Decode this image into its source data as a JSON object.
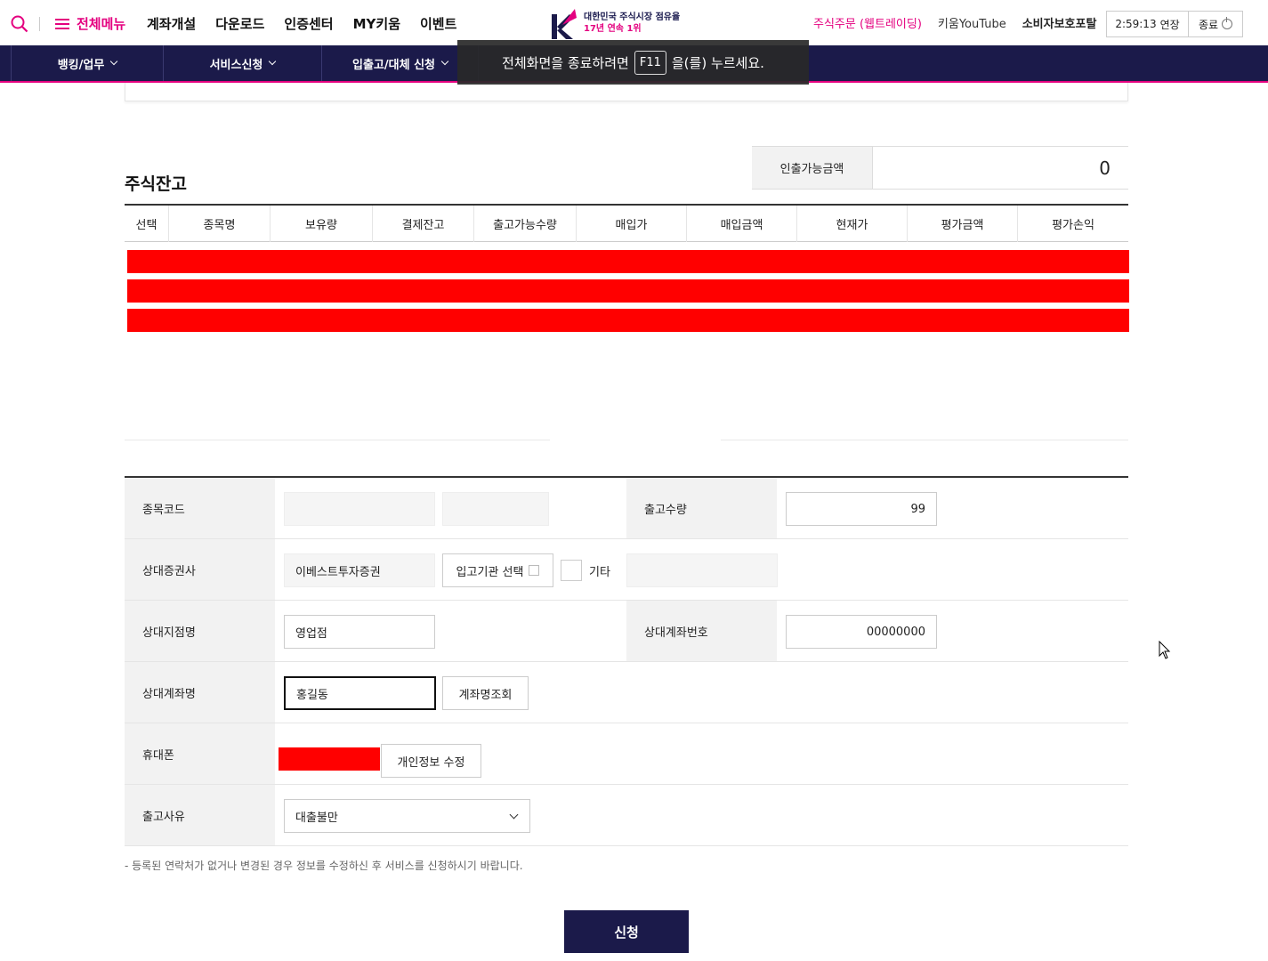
{
  "header": {
    "menu_all": "전체메뉴",
    "nav": [
      "계좌개설",
      "다운로드",
      "인증센터",
      "MY키움",
      "이벤트"
    ],
    "logo_line1": "대한민국 주식시장 점유율",
    "logo_line2": "17년 연속 1위",
    "links": [
      "주식주문 (웹트레이딩)",
      "키움YouTube",
      "소비자보호포탈"
    ],
    "timer": "2:59:13",
    "extend": "연장",
    "logout": "종료"
  },
  "navbar": {
    "items": [
      "뱅킹/업무",
      "서비스신청",
      "입출고/대체 신청"
    ]
  },
  "toast": {
    "before": "전체화면을 종료하려면",
    "key": "F11",
    "after": "을(를) 누르세요."
  },
  "stock": {
    "title": "주식잔고",
    "withdraw_label": "인출가능금액",
    "withdraw_value": "0",
    "columns": [
      "선택",
      "종목명",
      "보유량",
      "결제잔고",
      "출고가능수량",
      "매입가",
      "매입금액",
      "현재가",
      "평가금액",
      "평가손익"
    ]
  },
  "form": {
    "code_label": "종목코드",
    "qty_label": "출고수량",
    "qty_value": "99",
    "broker_label": "상대증권사",
    "broker_value": "이베스트투자증권",
    "broker_select": "입고기관 선택",
    "other_label": "기타",
    "branch_label": "상대지점명",
    "branch_value": "영업점",
    "account_no_label": "상대계좌번호",
    "account_no_value": "00000000",
    "account_name_label": "상대계좌명",
    "account_name_value": "홍길동",
    "account_lookup": "계좌명조회",
    "phone_label": "휴대폰",
    "edit_info": "개인정보 수정",
    "reason_label": "출고사유",
    "reason_value": "대출불만"
  },
  "note": "- 등록된 연락처가 없거나 변경된 경우 정보를 수정하신 후 서비스를 신청하시기 바랍니다.",
  "submit": "신청",
  "colors": {
    "brand_pink": "#e4007f",
    "navy": "#1b1a4a",
    "redaction": "#ff0000"
  }
}
